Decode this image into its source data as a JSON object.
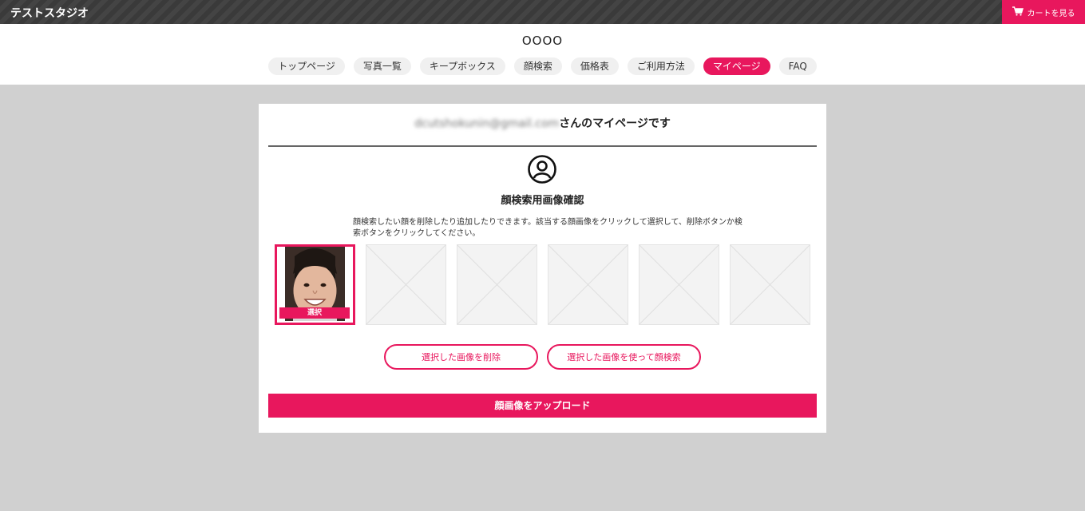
{
  "brand": "テストスタジオ",
  "cart": {
    "label": "カートを見る"
  },
  "site_title": "OOOO",
  "nav": [
    {
      "label": "トップページ",
      "active": false
    },
    {
      "label": "写真一覧",
      "active": false
    },
    {
      "label": "キープボックス",
      "active": false
    },
    {
      "label": "顔検索",
      "active": false
    },
    {
      "label": "価格表",
      "active": false
    },
    {
      "label": "ご利用方法",
      "active": false
    },
    {
      "label": "マイページ",
      "active": true
    },
    {
      "label": "FAQ",
      "active": false
    }
  ],
  "mypage": {
    "email": "dcutshokunin@gmail.com",
    "heading_suffix": "さんのマイページです",
    "section_title": "顔検索用画像確認",
    "description": "顔検索したい顔を削除したり追加したりできます。該当する顔画像をクリックして選択して、削除ボタンか検索ボタンをクリックしてください。",
    "thumbnails": [
      {
        "type": "photo",
        "selected": true,
        "badge": "選択"
      },
      {
        "type": "placeholder",
        "selected": false
      },
      {
        "type": "placeholder",
        "selected": false
      },
      {
        "type": "placeholder",
        "selected": false
      },
      {
        "type": "placeholder",
        "selected": false
      },
      {
        "type": "placeholder",
        "selected": false
      }
    ],
    "delete_button": "選択した画像を削除",
    "search_button": "選択した画像を使って顔検索",
    "upload_button": "顔画像をアップロード"
  },
  "colors": {
    "accent": "#e8175d",
    "topbar": "#3a3a3a",
    "background": "#d0d0d0"
  }
}
